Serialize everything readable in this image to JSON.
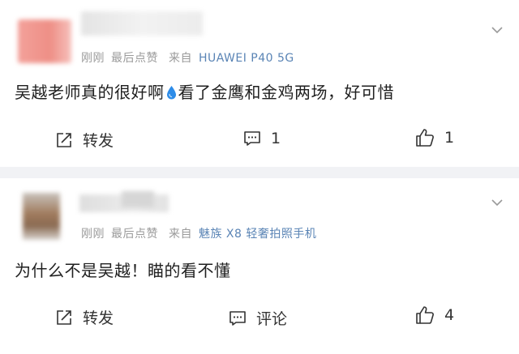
{
  "comments": [
    {
      "time": "刚刚",
      "last_edit": "最后点赞",
      "from_label": "来自",
      "device": "HUAWEI P40 5G",
      "text_before": "吴越老师真的很好啊",
      "emoji": "droplet",
      "text_after": "看了金鹰和金鸡两场，好可惜",
      "share_label": "转发",
      "comment_label": "1",
      "like_count": "1"
    },
    {
      "time": "刚刚",
      "last_edit": "最后点赞",
      "from_label": "来自",
      "device": "魅族 X8 轻奢拍照手机",
      "text": "为什么不是吴越！瞄的看不懂",
      "share_label": "转发",
      "comment_label": "评论",
      "like_count": "4"
    }
  ],
  "icons": {
    "share": "share-icon",
    "comment": "comment-icon",
    "like": "thumbs-up-icon",
    "more": "chevron-down-icon",
    "emoji": "droplet-icon"
  },
  "colors": {
    "device_link": "#5a84b5",
    "meta_gray": "#9a9a9a",
    "text": "#1f1f1f",
    "divider": "#f1f2f5",
    "emoji_blue": "#2d8ce8"
  }
}
